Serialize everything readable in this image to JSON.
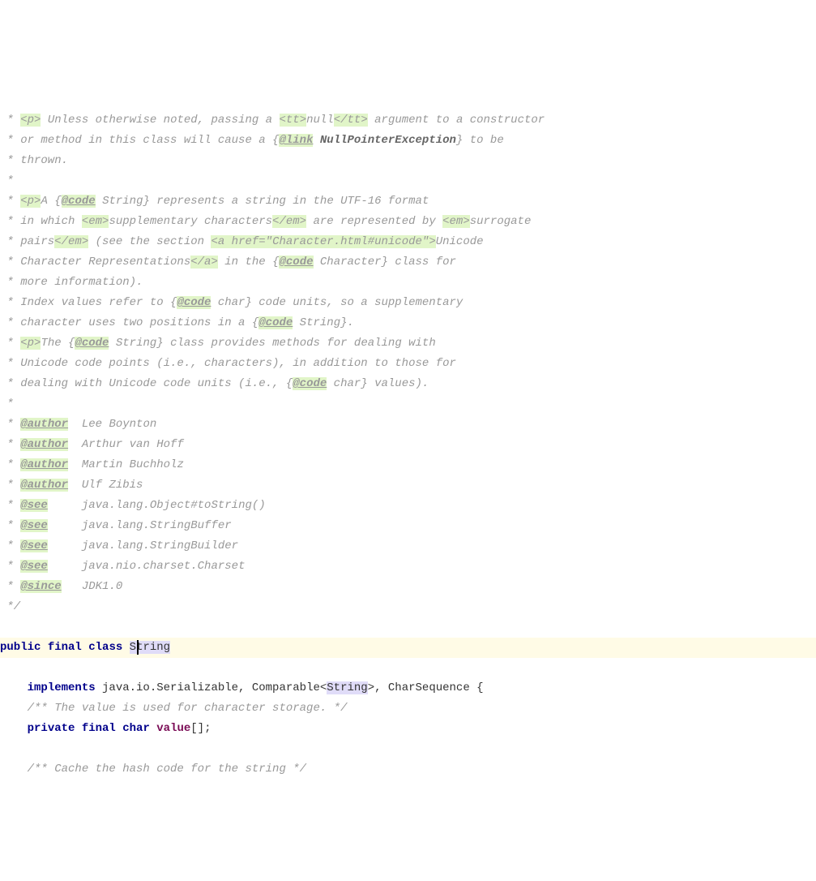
{
  "lines": {
    "l1a": " * ",
    "l1_p": "<p>",
    "l1b": " Unless otherwise noted, passing a ",
    "l1_tt1": "<tt>",
    "l1c": "null",
    "l1_tt2": "</tt>",
    "l1d": " argument to a constructor",
    "l2": " * or method in this class will cause a {",
    "l2_tag": "@link",
    "l2b": " ",
    "l2_link": "NullPointerException",
    "l2c": "} to be",
    "l3": " * thrown.",
    "l4": " *",
    "l5a": " * ",
    "l5_p": "<p>",
    "l5b": "A {",
    "l5_tag": "@code",
    "l5c": " String} represents a string in the UTF-16 format",
    "l6a": " * in which ",
    "l6_em1": "<em>",
    "l6b": "supplementary characters",
    "l6_em2": "</em>",
    "l6c": " are represented by ",
    "l6_em3": "<em>",
    "l6d": "surrogate",
    "l7a": " * pairs",
    "l7_em": "</em>",
    "l7b": " (see the section ",
    "l7_a": "<a href=\"Character.html#unicode\">",
    "l7c": "Unicode",
    "l8a": " * Character Representations",
    "l8_a": "</a>",
    "l8b": " in the {",
    "l8_tag": "@code",
    "l8c": " Character} class for",
    "l9": " * more information).",
    "l10a": " * Index values refer to {",
    "l10_tag": "@code",
    "l10b": " char} code units, so a supplementary",
    "l11a": " * character uses two positions in a {",
    "l11_tag": "@code",
    "l11b": " String}.",
    "l12a": " * ",
    "l12_p": "<p>",
    "l12b": "The {",
    "l12_tag": "@code",
    "l12c": " String} class provides methods for dealing with",
    "l13": " * Unicode code points (i.e., characters), in addition to those for",
    "l14a": " * dealing with Unicode code units (i.e., {",
    "l14_tag": "@code",
    "l14b": " char} values).",
    "l15": " *",
    "l16a": " * ",
    "l16_tag": "@author",
    "l16b": "  Lee Boynton",
    "l17a": " * ",
    "l17_tag": "@author",
    "l17b": "  Arthur van Hoff",
    "l18a": " * ",
    "l18_tag": "@author",
    "l18b": "  Martin Buchholz",
    "l19a": " * ",
    "l19_tag": "@author",
    "l19b": "  Ulf Zibis",
    "l20a": " * ",
    "l20_tag": "@see",
    "l20b": "     java.lang.Object#toString()",
    "l21a": " * ",
    "l21_tag": "@see",
    "l21b": "     java.lang.StringBuffer",
    "l22a": " * ",
    "l22_tag": "@see",
    "l22b": "     java.lang.StringBuilder",
    "l23a": " * ",
    "l23_tag": "@see",
    "l23b": "     java.nio.charset.Charset",
    "l24a": " * ",
    "l24_tag": "@since",
    "l24b": "   JDK1.0",
    "l25": " */",
    "blank": "",
    "cls_public": "public",
    "cls_final": "final",
    "cls_class": "class",
    "cls_name": "String",
    "impl_indent": "    ",
    "impl_kw": "implements",
    "impl_rest1": " java.io.Serializable, Comparable<",
    "impl_string": "String",
    "impl_rest2": ">, CharSequence {",
    "doc_value": "    /** The value is used for character storage. */",
    "fld_indent": "    ",
    "fld_private": "private",
    "fld_final": "final",
    "fld_char": "char",
    "fld_name": "value",
    "fld_rest": "[];",
    "doc_hash": "    /** Cache the hash code for the string */"
  }
}
